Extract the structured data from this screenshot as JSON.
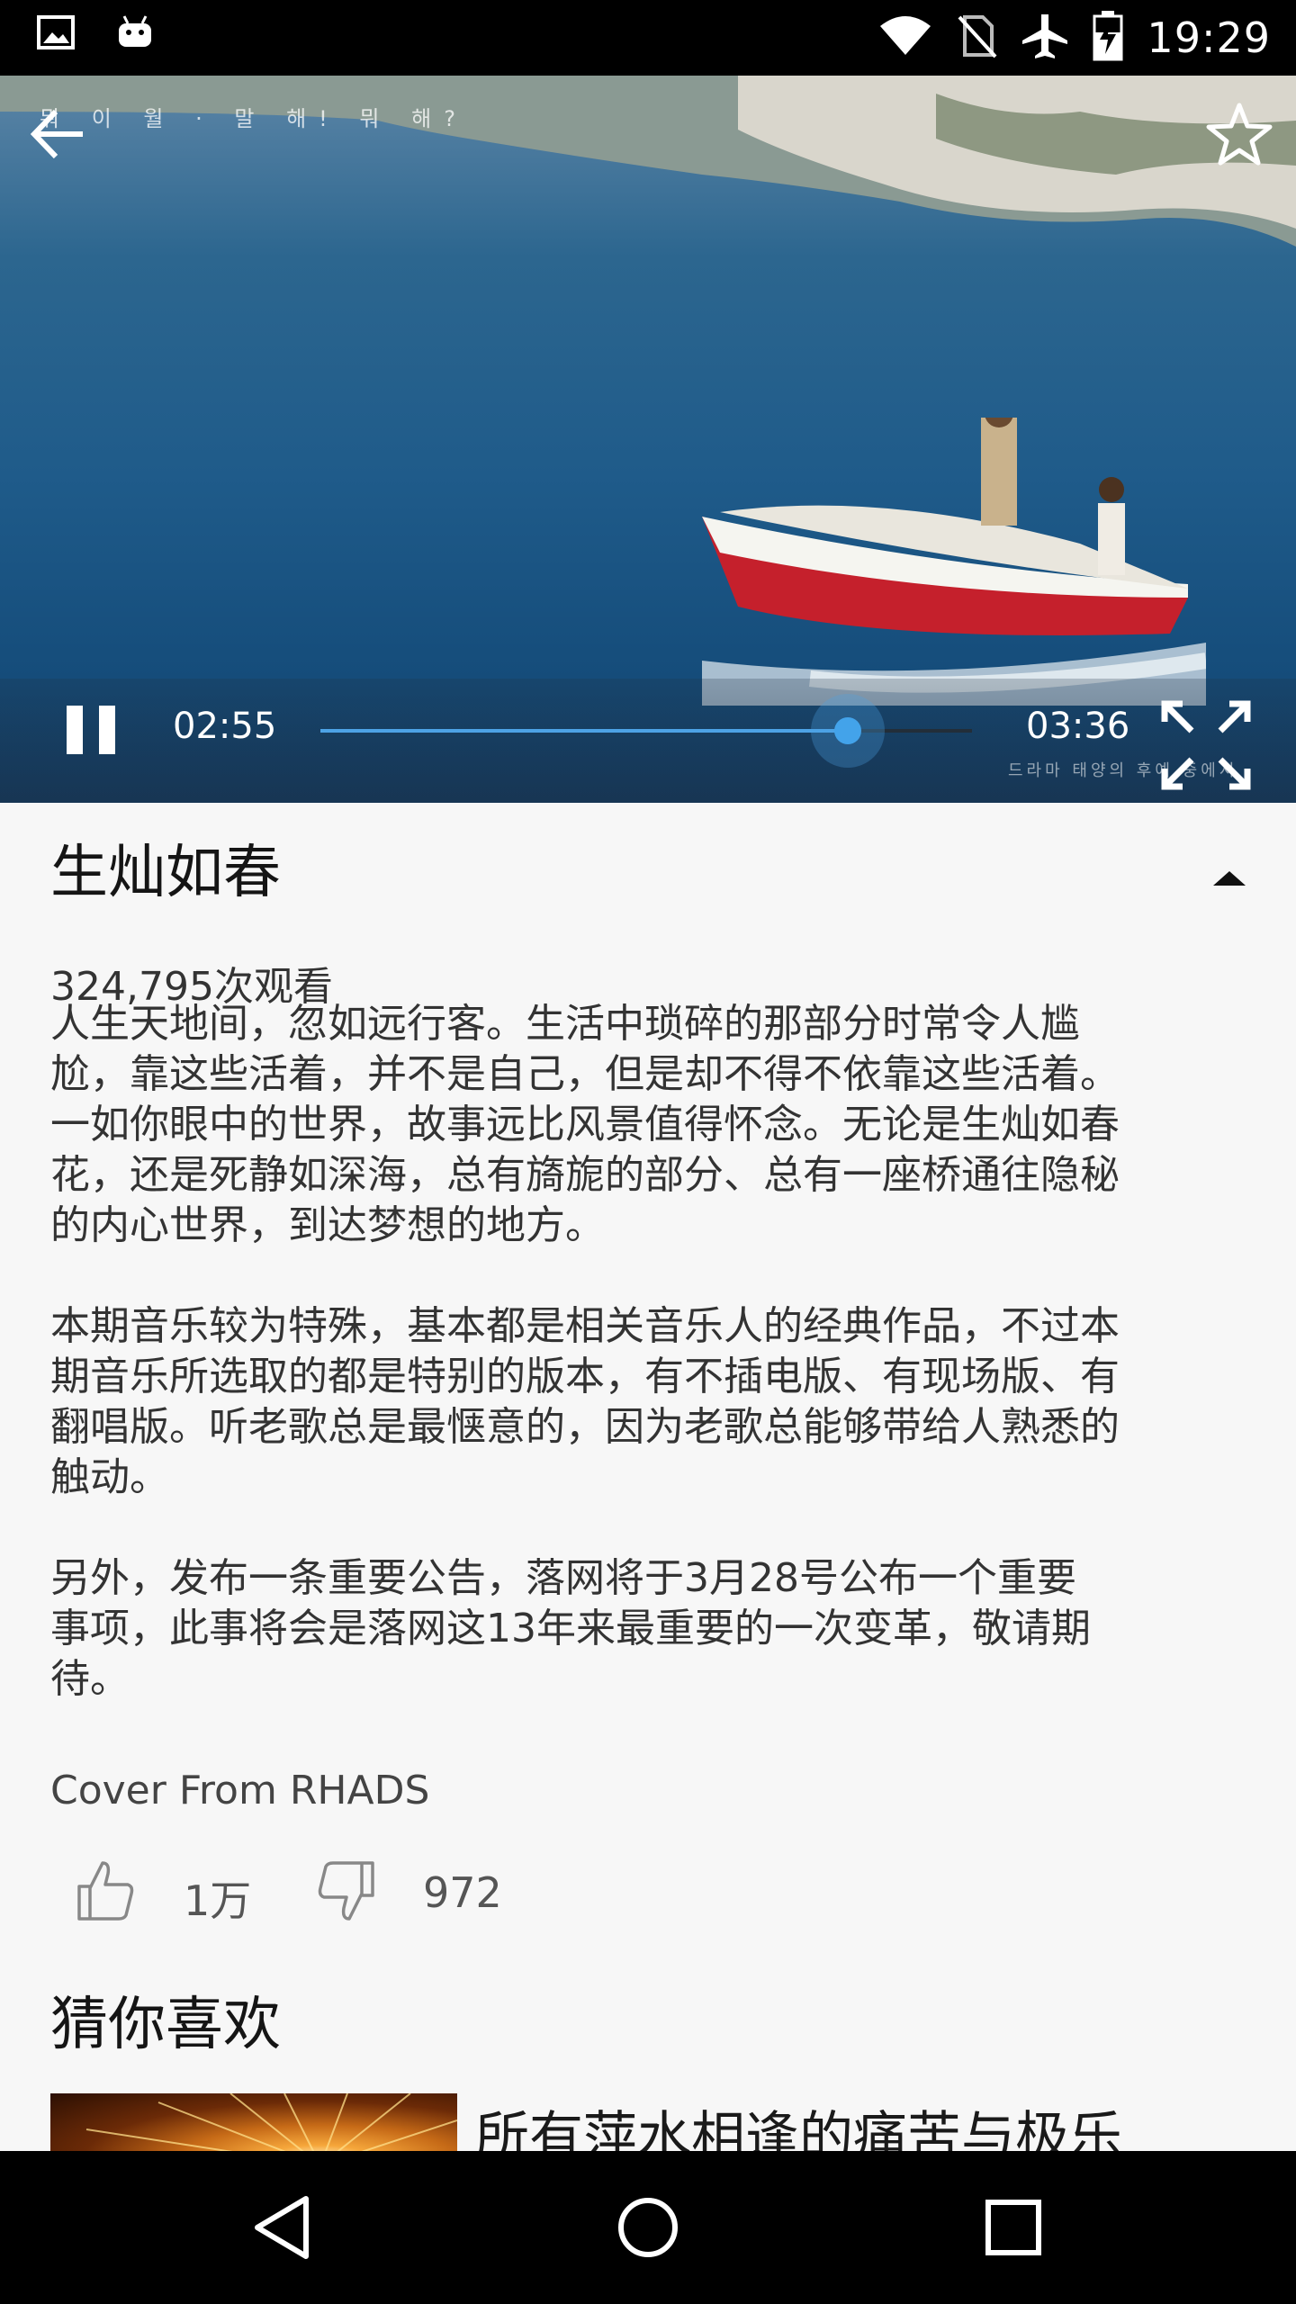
{
  "status_bar": {
    "time": "19:29",
    "icons": [
      "image-icon",
      "android-icon",
      "wifi-icon",
      "no-sim-icon",
      "airplane-icon",
      "battery-charging-icon"
    ]
  },
  "video": {
    "subtitle_overlay": "뭐 이 월 · 말 해! 뭐 해?",
    "watermark": "드라마 태양의 후예 중에서",
    "current_time": "02:55",
    "total_time": "03:36",
    "progress": 0.81,
    "state": "playing"
  },
  "info": {
    "title": "生灿如春",
    "views": "324,795次观看",
    "paragraphs": [
      "人生天地间，忽如远行客。生活中琐碎的那部分时常令人尴\n尬，靠这些活着，并不是自己，但是却不得不依靠这些活着。\n一如你眼中的世界，故事远比风景值得怀念。无论是生灿如春\n花，还是死静如深海，总有旖旎的部分、总有一座桥通往隐秘\n的内心世界，到达梦想的地方。",
      "本期音乐较为特殊，基本都是相关音乐人的经典作品，不过本\n期音乐所选取的都是特别的版本，有不插电版、有现场版、有\n翻唱版。听老歌总是最惬意的，因为老歌总能够带给人熟悉的\n触动。",
      "另外，发布一条重要公告，落网将于3月28号公布一个重要\n事项，此事将会是落网这13年来最重要的一次变革，敬请期\n待。"
    ],
    "credit": "Cover From RHADS",
    "likes": "1万",
    "dislikes": "972"
  },
  "recommendations": {
    "section_title": "猜你喜欢",
    "items": [
      {
        "title": "所有萍水相逢的痛苦与极乐"
      }
    ]
  },
  "colors": {
    "accent": "#43a3ea",
    "background": "#f7f7f7",
    "text": "#333333"
  }
}
